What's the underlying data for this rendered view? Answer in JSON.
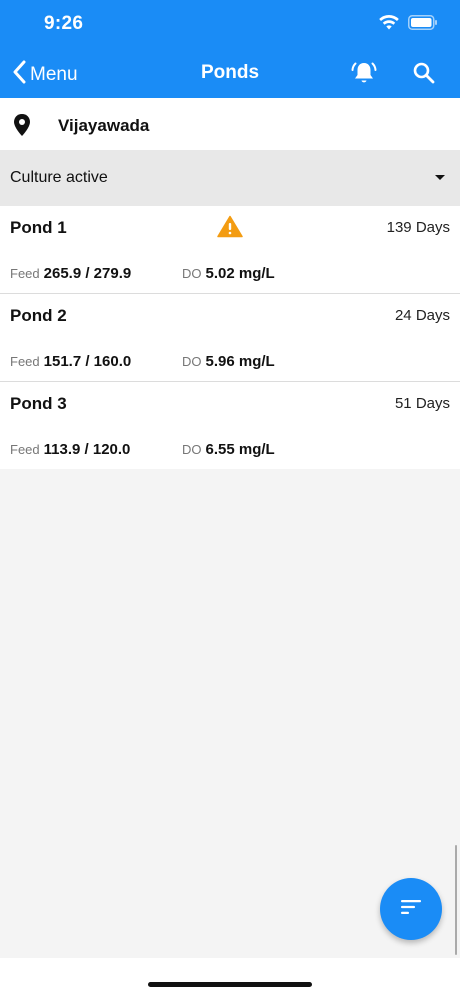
{
  "status_bar": {
    "time": "9:26"
  },
  "nav": {
    "back_label": "Menu",
    "title": "Ponds"
  },
  "location": {
    "name": "Vijayawada"
  },
  "filter": {
    "selected": "Culture active"
  },
  "ponds": [
    {
      "name": "Pond 1",
      "days": "139 Days",
      "warning": true,
      "feed_label": "Feed",
      "feed": "265.9 / 279.9",
      "do_label": "DO",
      "do": "5.02 mg/L"
    },
    {
      "name": "Pond 2",
      "days": "24 Days",
      "warning": false,
      "feed_label": "Feed",
      "feed": "151.7 / 160.0",
      "do_label": "DO",
      "do": "5.96 mg/L"
    },
    {
      "name": "Pond 3",
      "days": "51 Days",
      "warning": false,
      "feed_label": "Feed",
      "feed": "113.9 / 120.0",
      "do_label": "DO",
      "do": "6.55 mg/L"
    }
  ],
  "colors": {
    "primary": "#1a8cf6",
    "warning": "#f39c12",
    "background": "#f4f4f4",
    "filter_bg": "#e8e8e8"
  },
  "icons": {
    "back": "chevron-left-icon",
    "bell": "bell-ring-icon",
    "search": "search-icon",
    "location": "map-pin-icon",
    "warning": "warning-triangle-icon",
    "fab": "sort-icon"
  }
}
